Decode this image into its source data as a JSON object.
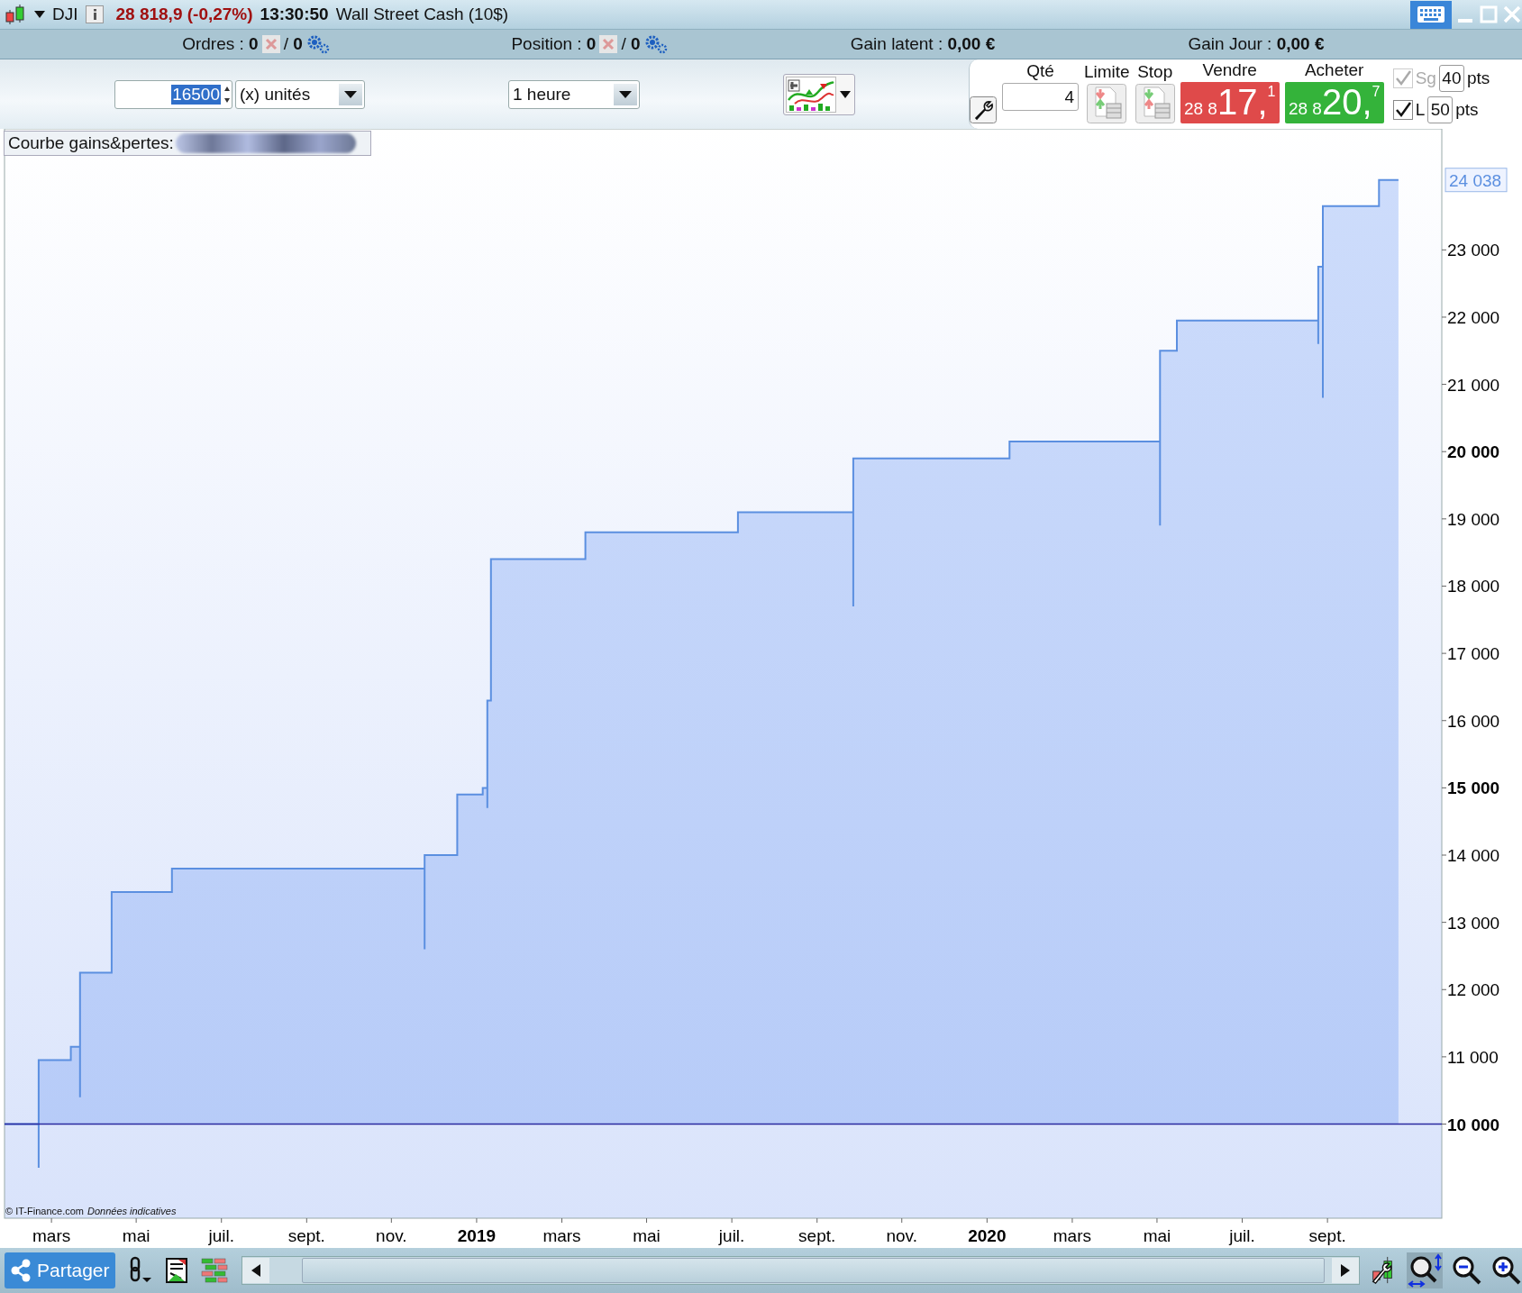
{
  "title_bar": {
    "instrument": "DJI",
    "price": "28 818,9 (-0,27%)",
    "time": "13:30:50",
    "name": "Wall Street Cash (10$)"
  },
  "account_bar": [
    {
      "kind": "orders",
      "text": "Ordres : **0**",
      "suffix": "/ **0**"
    },
    {
      "kind": "orders",
      "text": "Position : **0**",
      "suffix": "/ **0**"
    },
    {
      "kind": "gain",
      "text": "Gain latent : **0,00 €**"
    },
    {
      "kind": "gain",
      "text": "Gain Jour : **0,00 €**"
    }
  ],
  "toolbar": {
    "quantity_field": {
      "value": "16500"
    },
    "unit_dropdown": {
      "value": "(x) unités"
    },
    "period_dropdown": {
      "value": "1 heure"
    }
  },
  "order_panel": {
    "qty_label": "Qté",
    "qty_value": "4",
    "limit_label": "Limite",
    "stop_label": "Stop",
    "sell": {
      "label": "Vendre",
      "prefix": "28 8",
      "main": "17,",
      "sup": "1"
    },
    "buy": {
      "label": "Acheter",
      "prefix": "28 8",
      "main": "20,",
      "sup": "7"
    },
    "stops": [
      {
        "label": "Sg",
        "checked": true,
        "disabled": true,
        "value": "40",
        "unit": "pts"
      },
      {
        "label": "L",
        "checked": true,
        "disabled": false,
        "value": "50",
        "unit": "pts"
      }
    ]
  },
  "chart": {
    "title": "Courbe gains&pertes:",
    "credit": "© IT-Finance.com",
    "credit_note": "Données indicatives",
    "price_label": "24 038",
    "chart_data": {
      "type": "area",
      "xlim": [
        2018.075,
        2020.891
      ],
      "ylim": [
        8600,
        24800
      ],
      "x": [
        2018.075,
        2018.142,
        2018.142,
        2018.142,
        2018.205,
        2018.205,
        2018.223,
        2018.223,
        2018.223,
        2018.285,
        2018.285,
        2018.403,
        2018.403,
        2018.898,
        2018.898,
        2018.898,
        2018.962,
        2018.962,
        2019.012,
        2019.012,
        2019.021,
        2019.021,
        2019.021,
        2019.028,
        2019.028,
        2019.213,
        2019.213,
        2019.512,
        2019.512,
        2019.738,
        2019.738,
        2019.738,
        2020.044,
        2020.044,
        2020.339,
        2020.339,
        2020.339,
        2020.372,
        2020.372,
        2020.649,
        2020.649,
        2020.649,
        2020.658,
        2020.658,
        2020.658,
        2020.768,
        2020.768,
        2020.806
      ],
      "series": [
        {
          "color": "#5b8fe0",
          "values": [
            10000,
            10000,
            9350,
            10950,
            10950,
            11150,
            11150,
            10400,
            12250,
            12250,
            13450,
            13450,
            13800,
            13800,
            12600,
            14000,
            14000,
            14900,
            14900,
            15000,
            15000,
            14700,
            16300,
            16300,
            18400,
            18400,
            18800,
            18800,
            19100,
            19100,
            17700,
            19900,
            19900,
            20150,
            20150,
            18900,
            21500,
            21500,
            21950,
            21950,
            21600,
            22750,
            22750,
            20800,
            23650,
            23650,
            24040,
            24040
          ]
        }
      ],
      "xticks": [
        {
          "value": 2018.167,
          "label": "mars"
        },
        {
          "value": 2018.333,
          "label": "mai"
        },
        {
          "value": 2018.5,
          "label": "juil."
        },
        {
          "value": 2018.667,
          "label": "sept."
        },
        {
          "value": 2018.833,
          "label": "nov."
        },
        {
          "value": 2019,
          "label": "2019"
        },
        {
          "value": 2019.167,
          "label": "mars"
        },
        {
          "value": 2019.333,
          "label": "mai"
        },
        {
          "value": 2019.5,
          "label": "juil."
        },
        {
          "value": 2019.667,
          "label": "sept."
        },
        {
          "value": 2019.833,
          "label": "nov."
        },
        {
          "value": 2020,
          "label": "2020"
        },
        {
          "value": 2020.167,
          "label": "mars"
        },
        {
          "value": 2020.333,
          "label": "mai"
        },
        {
          "value": 2020.5,
          "label": "juil."
        },
        {
          "value": 2020.667,
          "label": "sept."
        }
      ],
      "yticks": [
        {
          "value": 10000,
          "label": "10 000"
        },
        {
          "value": 11000,
          "label": "11 000"
        },
        {
          "value": 12000,
          "label": "12 000"
        },
        {
          "value": 13000,
          "label": "13 000"
        },
        {
          "value": 14000,
          "label": "14 000"
        },
        {
          "value": 15000,
          "label": "15 000"
        },
        {
          "value": 16000,
          "label": "16 000"
        },
        {
          "value": 17000,
          "label": "17 000"
        },
        {
          "value": 18000,
          "label": "18 000"
        },
        {
          "value": 19000,
          "label": "19 000"
        },
        {
          "value": 20000,
          "label": "20 000"
        },
        {
          "value": 21000,
          "label": "21 000"
        },
        {
          "value": 22000,
          "label": "22 000"
        },
        {
          "value": 23000,
          "label": "23 000"
        }
      ],
      "ref_lines": [
        {
          "axis": "y",
          "value": 10000,
          "color": "#2a2aa0"
        }
      ]
    }
  },
  "bottom_bar": {
    "share_button": "Partager"
  }
}
